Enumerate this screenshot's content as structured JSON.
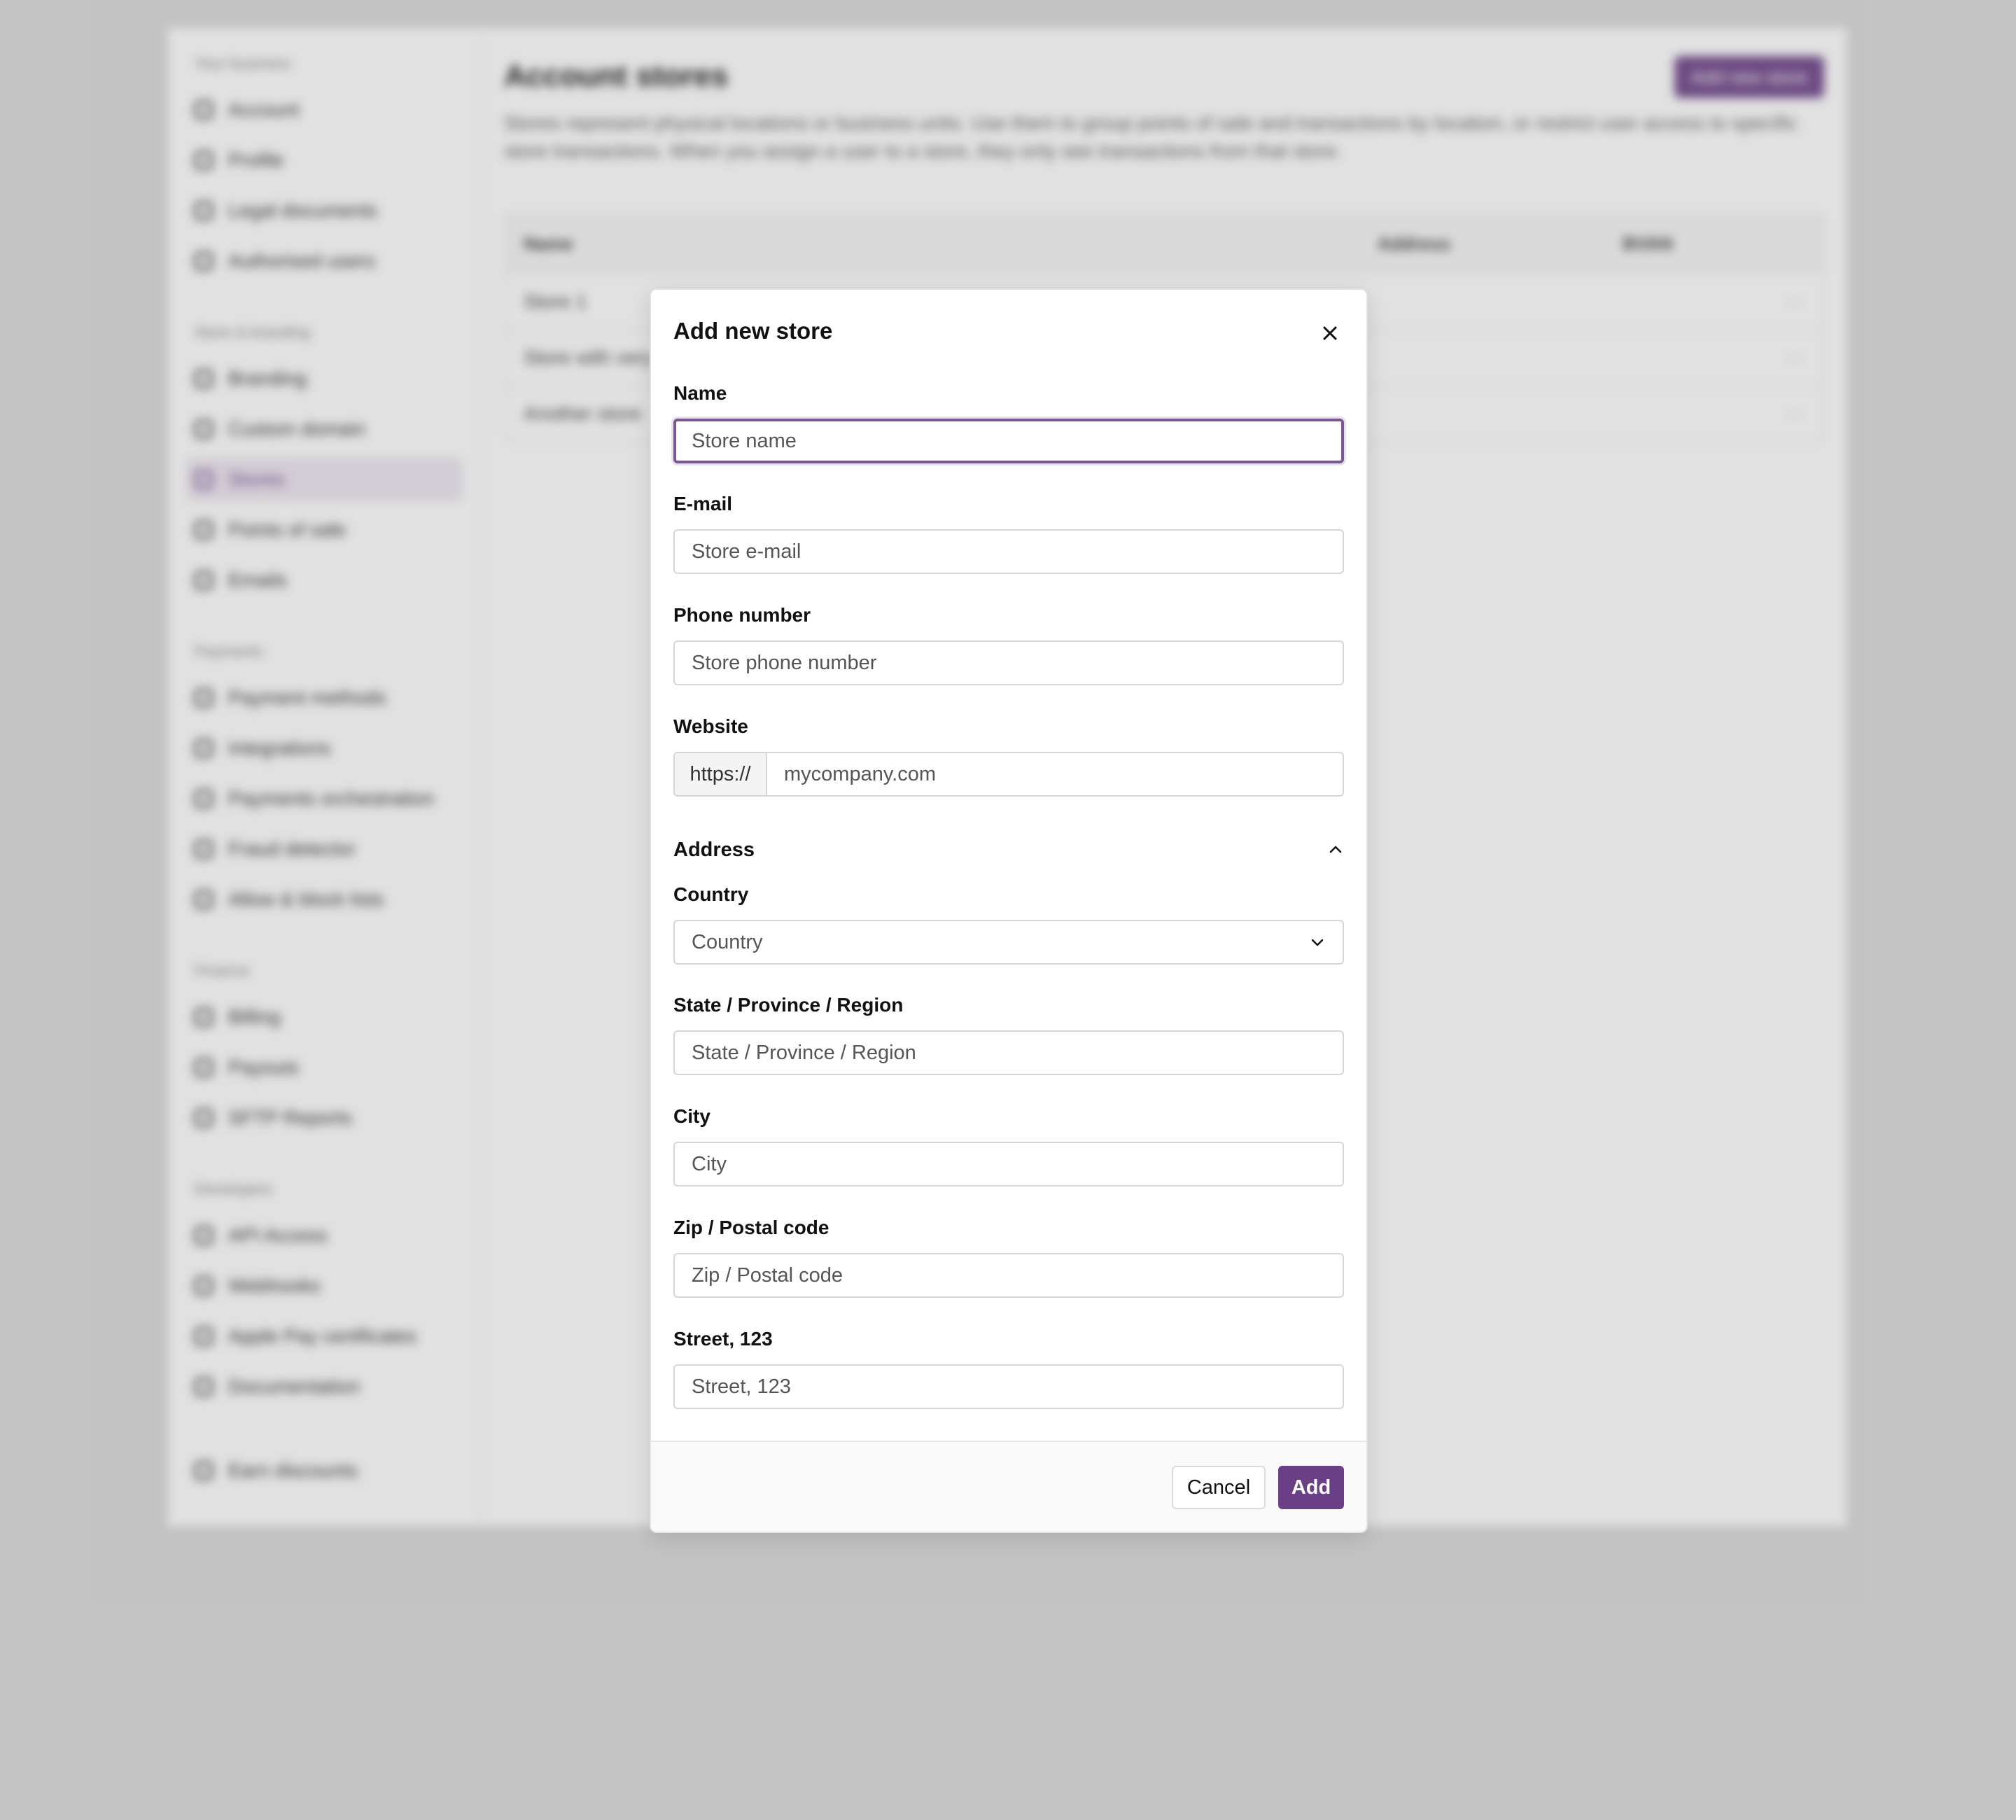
{
  "background": {
    "sidebar": [
      {
        "heading": "Your business",
        "items": [
          {
            "label": "Account"
          },
          {
            "label": "Profile"
          },
          {
            "label": "Legal documents"
          },
          {
            "label": "Authorised users"
          }
        ]
      },
      {
        "heading": "Store & branding",
        "items": [
          {
            "label": "Branding"
          },
          {
            "label": "Custom domain"
          },
          {
            "label": "Stores",
            "active": true
          },
          {
            "label": "Points of sale"
          },
          {
            "label": "Emails"
          }
        ]
      },
      {
        "heading": "Payments",
        "items": [
          {
            "label": "Payment methods"
          },
          {
            "label": "Integrations"
          },
          {
            "label": "Payments orchestration"
          },
          {
            "label": "Fraud detector"
          },
          {
            "label": "Allow & block lists"
          }
        ]
      },
      {
        "heading": "Finance",
        "items": [
          {
            "label": "Billing"
          },
          {
            "label": "Payouts"
          },
          {
            "label": "SFTP Reports"
          }
        ]
      },
      {
        "heading": "Developers",
        "items": [
          {
            "label": "API Access"
          },
          {
            "label": "Webhooks"
          },
          {
            "label": "Apple Pay certificates"
          },
          {
            "label": "Documentation"
          }
        ]
      },
      {
        "heading": "",
        "items": [
          {
            "label": "Earn discounts"
          }
        ]
      }
    ],
    "page_title": "Account stores",
    "add_store_label": "Add new store",
    "description": "Stores represent physical locations or business units. Use them to group points of sale and transactions by location, or restrict user access to specific store transactions. When you assign a user to a store, they only see transactions from that store.",
    "table": {
      "headers": [
        "Name",
        "Address",
        "BVAN"
      ],
      "rows": [
        [
          "Store 1"
        ],
        [
          "Store with very long name"
        ],
        [
          "Another store"
        ]
      ]
    }
  },
  "modal": {
    "title": "Add new store",
    "fields": {
      "name": {
        "label": "Name",
        "placeholder": "Store name"
      },
      "email": {
        "label": "E-mail",
        "placeholder": "Store e-mail"
      },
      "phone": {
        "label": "Phone number",
        "placeholder": "Store phone number"
      },
      "website": {
        "label": "Website",
        "prefix": "https://",
        "placeholder": "mycompany.com"
      }
    },
    "address": {
      "section_title": "Address",
      "country": {
        "label": "Country",
        "selected": "Country"
      },
      "state": {
        "label": "State / Province / Region",
        "placeholder": "State / Province / Region"
      },
      "city": {
        "label": "City",
        "placeholder": "City"
      },
      "zip": {
        "label": "Zip / Postal code",
        "placeholder": "Zip / Postal code"
      },
      "street": {
        "label": "Street, 123",
        "placeholder": "Street, 123"
      }
    },
    "footer": {
      "cancel_label": "Cancel",
      "add_label": "Add"
    }
  },
  "colors": {
    "accent": "#6b3f86",
    "focus_ring": "#7b5691"
  },
  "icons": {
    "close": "close-icon",
    "collapse": "chevron-up-icon",
    "dropdown": "chevron-down-icon"
  }
}
